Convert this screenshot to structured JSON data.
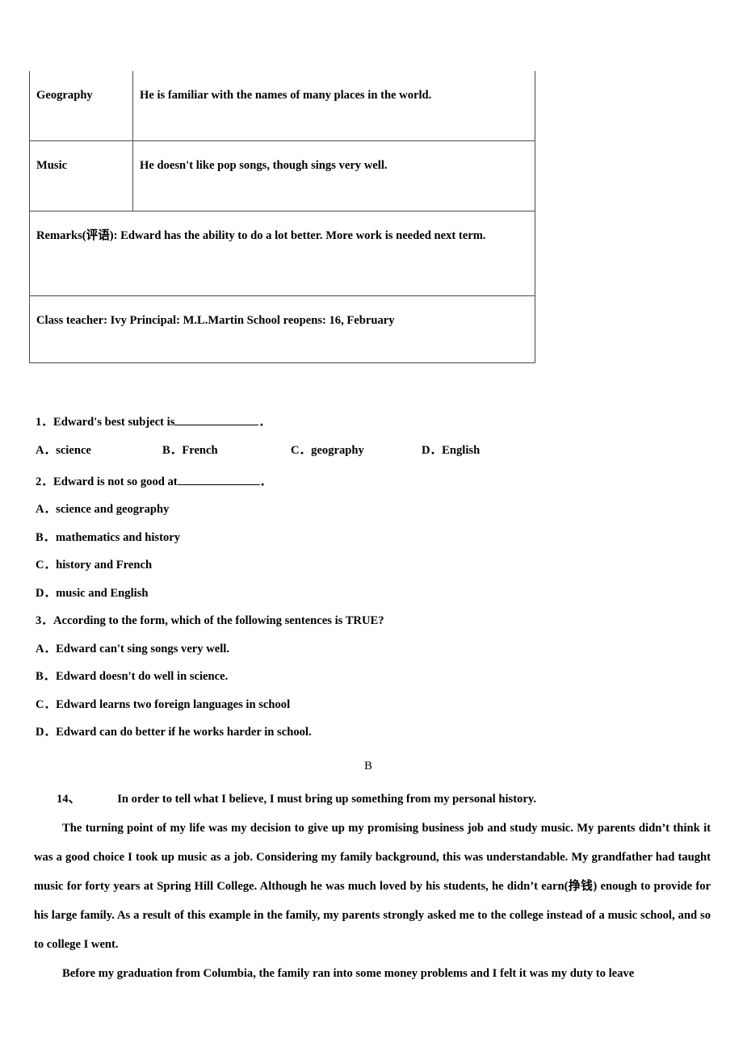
{
  "report_table": {
    "rows": [
      {
        "subject": "Geography",
        "comment": "He is familiar with the names of many places in the world.",
        "type": "subject"
      },
      {
        "subject": "Music",
        "comment": "He doesn't like pop songs, though sings very well.",
        "type": "subject"
      },
      {
        "full": "Remarks(评语): Edward has the ability to do a lot better. More work is needed next term.",
        "type": "remarks"
      },
      {
        "full": "Class teacher: Ivy Principal: M.L.Martin School reopens: 16, February",
        "type": "footer"
      }
    ]
  },
  "questions": [
    {
      "number": "1．",
      "stem_before": "Edward's best subject is",
      "stem_after": "．",
      "has_blank": true,
      "layout": "inline",
      "options": [
        {
          "letter": "A．",
          "text": "science"
        },
        {
          "letter": "B．",
          "text": "French"
        },
        {
          "letter": "C．",
          "text": "geography"
        },
        {
          "letter": "D．",
          "text": "English"
        }
      ]
    },
    {
      "number": "2．",
      "stem_before": "Edward is not so good at",
      "stem_after": "．",
      "has_blank": true,
      "layout": "stacked",
      "options": [
        {
          "letter": "A．",
          "text": "science and geography"
        },
        {
          "letter": "B．",
          "text": "mathematics and history"
        },
        {
          "letter": "C．",
          "text": "history and French"
        },
        {
          "letter": "D．",
          "text": "music and English"
        }
      ]
    },
    {
      "number": "3．",
      "stem_before": "According to the form, which of the following sentences is TRUE?",
      "stem_after": "",
      "has_blank": false,
      "layout": "stacked",
      "options": [
        {
          "letter": "A．",
          "text": "Edward can't sing songs very well."
        },
        {
          "letter": "B．",
          "text": "Edward doesn't do well in science."
        },
        {
          "letter": "C．",
          "text": "Edward learns two foreign languages in school"
        },
        {
          "letter": "D．",
          "text": "Edward can do better if he works harder in school."
        }
      ]
    }
  ],
  "answer_marker": "B",
  "passage": {
    "item_number": "14、",
    "head_text": "In order to tell what I believe, I must bring up something from my personal history.",
    "paragraphs": [
      "The turning point of my life was my decision to give up my promising business job and study music. My parents didn’t think it was a good choice I took up music as a job. Considering my family background, this was understandable. My grandfather had taught music for forty years at Spring Hill College. Although he was much loved by his students, he didn’t earn(挣钱) enough to provide for his large family. As a result of this example in the family, my parents strongly asked me to the college instead of a music school, and so to college I went.",
      "Before my graduation from Columbia, the family ran into some money problems and I felt it was my duty to leave"
    ]
  }
}
